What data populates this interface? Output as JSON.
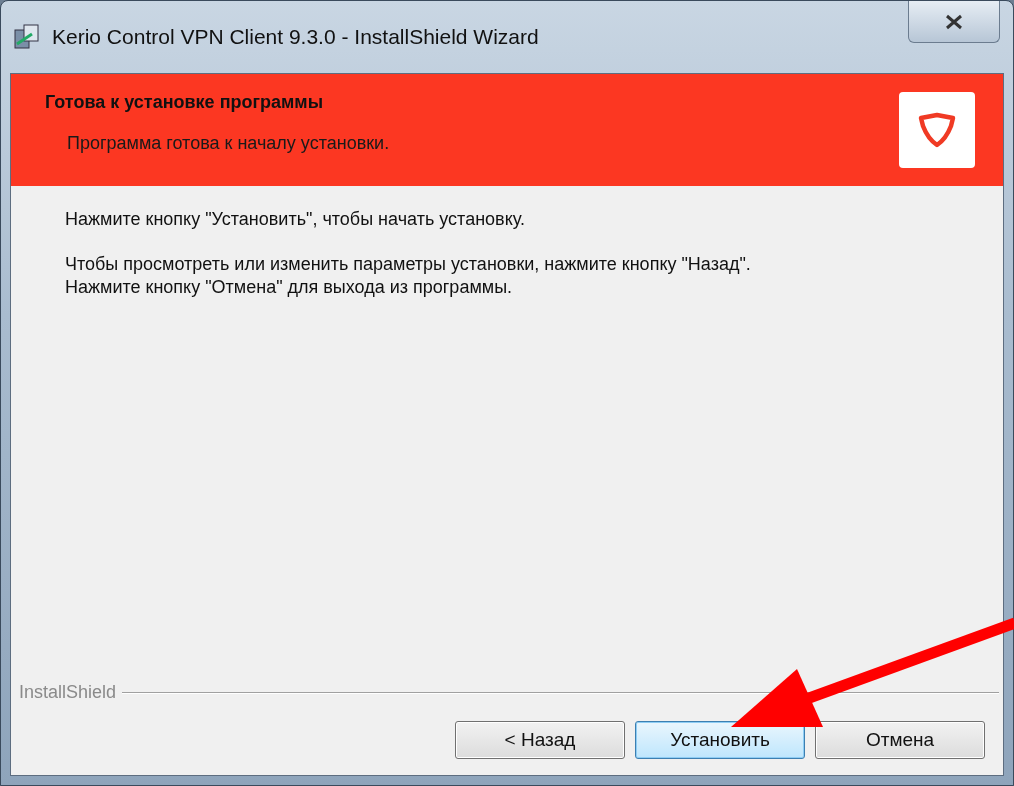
{
  "window": {
    "title": "Kerio Control VPN Client 9.3.0 - InstallShield Wizard"
  },
  "header": {
    "title": "Готова к установке программы",
    "subtitle": "Программа готова к началу установки."
  },
  "body": {
    "paragraphs": [
      "Нажмите кнопку \"Установить\", чтобы начать установку.",
      "Чтобы просмотреть или изменить параметры установки, нажмите кнопку \"Назад\".\nНажмите кнопку \"Отмена\" для выхода из программы."
    ]
  },
  "footer": {
    "brand": "InstallShield"
  },
  "buttons": [
    {
      "label": "< Назад",
      "default": false
    },
    {
      "label": "Установить",
      "default": true
    },
    {
      "label": "Отмена",
      "default": false
    }
  ]
}
